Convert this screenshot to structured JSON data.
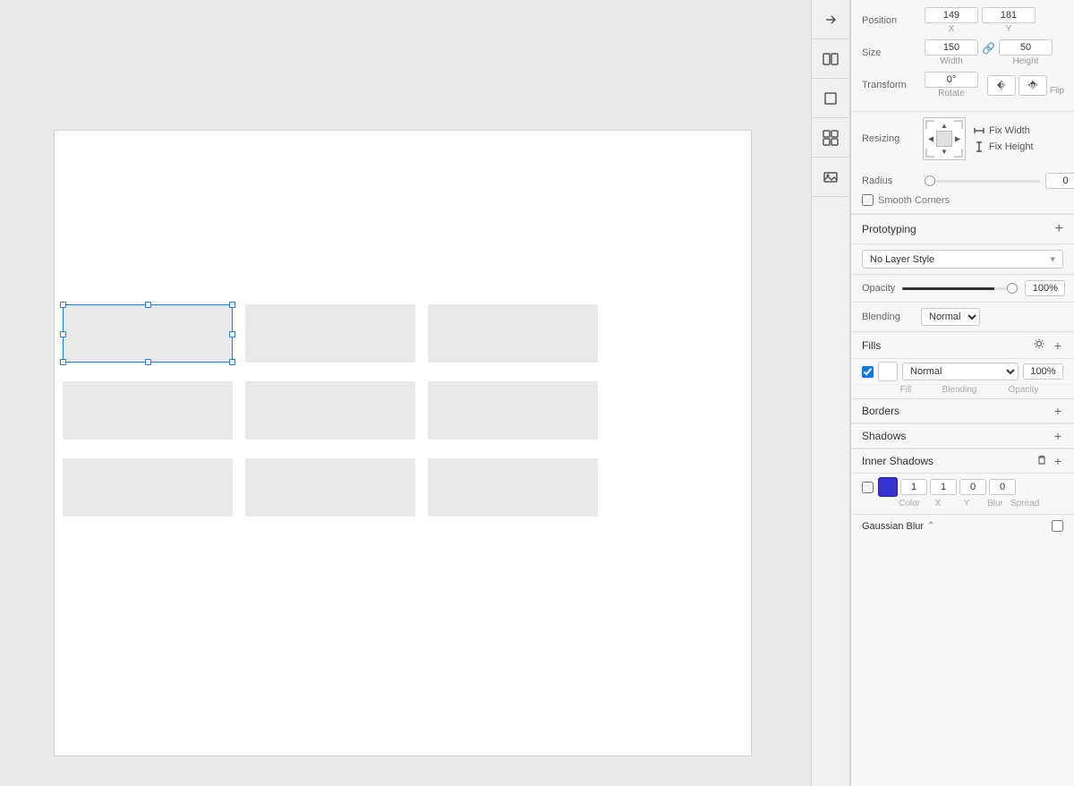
{
  "canvas": {
    "background": "#e8e8e8"
  },
  "toolbar": {
    "icons": [
      {
        "name": "arrow-tool-icon",
        "symbol": "↗"
      },
      {
        "name": "layout-icon",
        "symbol": "▦"
      },
      {
        "name": "square-icon",
        "symbol": "□"
      },
      {
        "name": "grid-icon",
        "symbol": "⊞"
      },
      {
        "name": "image-icon",
        "symbol": "⊡"
      }
    ]
  },
  "grid": {
    "items": [
      {
        "id": 1,
        "selected": true
      },
      {
        "id": 2,
        "selected": false
      },
      {
        "id": 3,
        "selected": false
      },
      {
        "id": 4,
        "selected": false
      },
      {
        "id": 5,
        "selected": false
      },
      {
        "id": 6,
        "selected": false
      },
      {
        "id": 7,
        "selected": false
      },
      {
        "id": 8,
        "selected": false
      },
      {
        "id": 9,
        "selected": false
      }
    ]
  },
  "properties": {
    "position": {
      "label": "Position",
      "x": {
        "value": "149",
        "label": "X"
      },
      "y": {
        "value": "181",
        "label": "Y"
      }
    },
    "size": {
      "label": "Size",
      "width": {
        "value": "150",
        "label": "Width"
      },
      "height": {
        "value": "50",
        "label": "Height"
      },
      "lock_icon": "🔒"
    },
    "transform": {
      "label": "Transform",
      "rotate": {
        "value": "0°",
        "label": "Rotate"
      },
      "flip_label": "Flip"
    },
    "resizing": {
      "label": "Resizing",
      "fix_width": "Fix Width",
      "fix_height": "Fix Height"
    },
    "radius": {
      "label": "Radius",
      "value": "0",
      "slider_value": 0
    },
    "smooth_corners": {
      "label": "Smooth Corners"
    },
    "prototyping": {
      "label": "Prototyping"
    },
    "layer_style": {
      "value": "No Layer Style"
    },
    "opacity": {
      "label": "Opacity",
      "value": "100%",
      "slider_value": 100
    },
    "blending": {
      "label": "Blending",
      "value": "Normal"
    },
    "fills": {
      "label": "Fills",
      "items": [
        {
          "enabled": true,
          "color": "#ffffff",
          "blending": "Normal",
          "opacity": "100%",
          "blending_label": "Blending",
          "opacity_label": "Opacity",
          "fill_label": "Fill"
        }
      ]
    },
    "borders": {
      "label": "Borders"
    },
    "shadows": {
      "label": "Shadows"
    },
    "inner_shadows": {
      "label": "Inner Shadows",
      "items": [
        {
          "enabled": false,
          "color": "#3333cc",
          "x": "1",
          "y": "1",
          "blur": "0",
          "spread": "0",
          "color_label": "Color",
          "x_label": "X",
          "y_label": "Y",
          "blur_label": "Blur",
          "spread_label": "Spread"
        }
      ]
    },
    "gaussian_blur": {
      "label": "Gaussian Blur",
      "enabled": false
    }
  }
}
